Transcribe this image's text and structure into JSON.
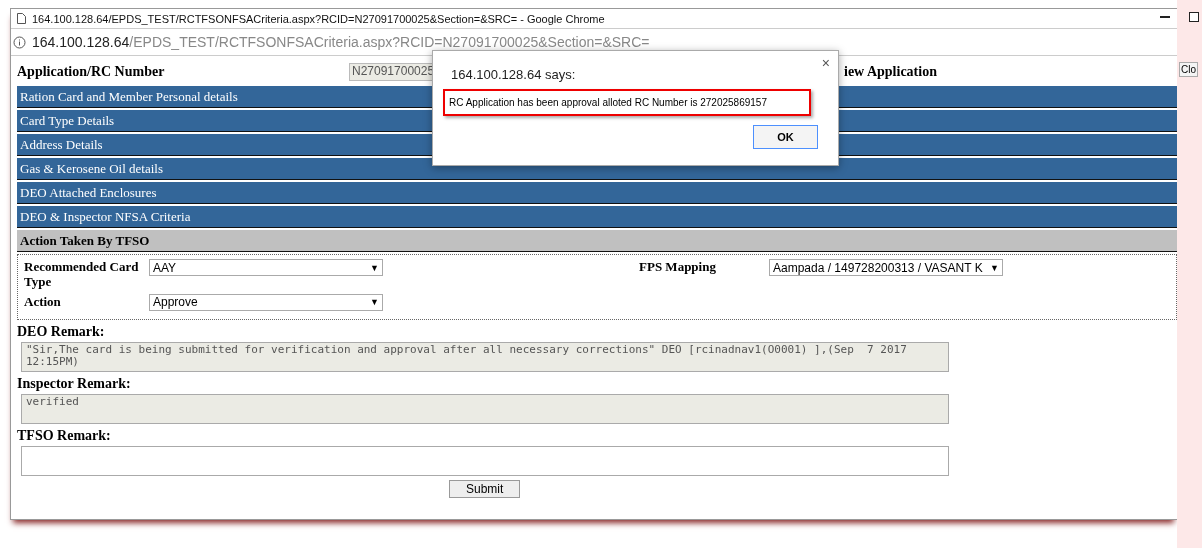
{
  "window": {
    "title": "164.100.128.64/EPDS_TEST/RCTFSONFSACriteria.aspx?RCID=N27091700025&Section=&SRC= - Google Chrome",
    "address_host": "164.100.128.64",
    "address_path": "/EPDS_TEST/RCTFSONFSACriteria.aspx?RCID=N27091700025&Section=&SRC="
  },
  "header": {
    "label": "Application/RC Number",
    "value": "N27091700025",
    "view_link": "iew Application",
    "close_button": "Clo"
  },
  "select_caret": "▼",
  "sections": [
    {
      "label": "Ration Card and Member Personal details",
      "expanded": false
    },
    {
      "label": "Card Type Details",
      "expanded": false
    },
    {
      "label": "Address Details",
      "expanded": false
    },
    {
      "label": "Gas & Kerosene Oil details",
      "expanded": false
    },
    {
      "label": "DEO Attached Enclosures",
      "expanded": false
    },
    {
      "label": "DEO & Inspector NFSA Criteria",
      "expanded": false
    },
    {
      "label": "Action Taken By TFSO",
      "expanded": true
    }
  ],
  "form": {
    "recommended_card_type": {
      "label": "Recommended Card Type",
      "value": "AAY"
    },
    "action": {
      "label": "Action",
      "value": "Approve"
    },
    "fps_mapping": {
      "label": "FPS Mapping",
      "value": "Aampada / 149728200313 / VASANT K"
    }
  },
  "remarks": [
    {
      "label": "DEO Remark:",
      "value": "\"Sir,The card is being submitted for verification and approval after all necessary corrections\" DEO [rcinadnav1(O0001) ],(Sep  7 2017 12:15PM)",
      "disabled": true
    },
    {
      "label": "Inspector Remark:",
      "value": "verified",
      "disabled": true
    },
    {
      "label": "TFSO Remark:",
      "disabled": false
    }
  ],
  "submit_button": "Submit",
  "dialog": {
    "title": "164.100.128.64 says:",
    "message": "RC Application has been approval alloted RC Number is  272025869157",
    "ok_button": "OK",
    "close": "×"
  }
}
